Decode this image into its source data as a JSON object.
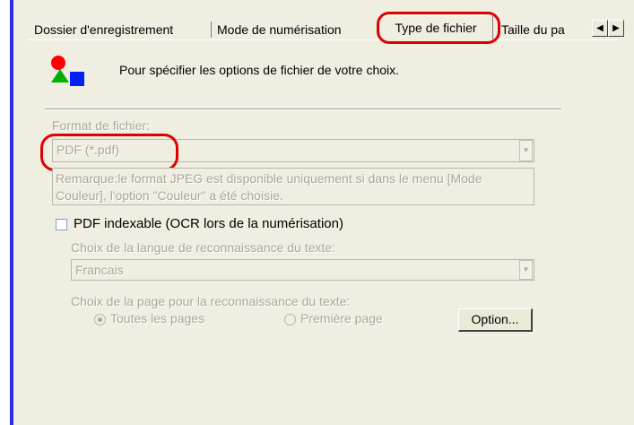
{
  "tabs": [
    {
      "label": "Dossier d'enregistrement"
    },
    {
      "label": "Mode de numérisation"
    },
    {
      "label": "Type de fichier",
      "active": true
    },
    {
      "label": "Taille du pa"
    }
  ],
  "tab_scroll": {
    "left_icon": "arrow-left-icon",
    "right_icon": "arrow-right-icon"
  },
  "intro": {
    "icon": "shapes-icon",
    "text": "Pour spécifier les options de fichier de votre choix."
  },
  "format": {
    "label": "Format de fichier:",
    "value": "PDF (*.pdf)",
    "remark": "Remarque:le format JPEG est disponible uniquement si dans le menu [Mode Couleur], l'option \"Couleur\" a été choisie."
  },
  "pdf_indexable": {
    "label": "PDF indexable (OCR lors de la numérisation)",
    "checked": false
  },
  "language": {
    "label": "Choix de la langue de reconnaissance du texte:",
    "value": "Francais"
  },
  "page_choice": {
    "label": "Choix de la page pour la reconnaissance du texte:",
    "options": [
      {
        "label": "Toutes les pages",
        "selected": true
      },
      {
        "label": "Première page",
        "selected": false
      }
    ]
  },
  "option_button": {
    "label": "Option..."
  },
  "colors": {
    "highlight": "#e00000",
    "accent_bar": "#2c2cf0",
    "dialog_bg": "#f0eee0"
  }
}
